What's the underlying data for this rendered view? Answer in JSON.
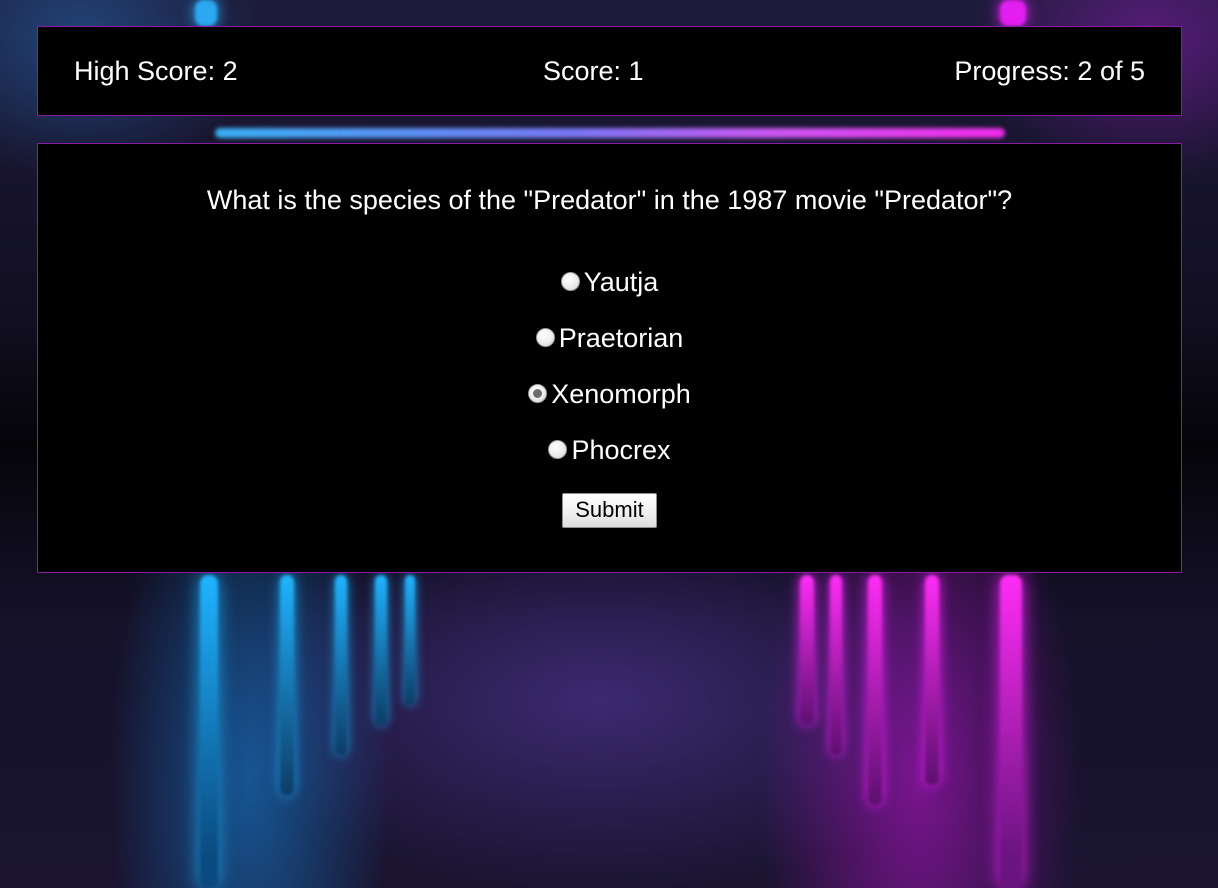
{
  "stats": {
    "high_score_label": "High Score: 2",
    "score_label": "Score: 1",
    "progress_label": "Progress: 2 of 5"
  },
  "quiz": {
    "question": "What is the species of the \"Predator\" in the 1987 movie \"Predator\"?",
    "options": [
      {
        "label": "Yautja",
        "selected": false
      },
      {
        "label": "Praetorian",
        "selected": false
      },
      {
        "label": "Xenomorph",
        "selected": true
      },
      {
        "label": "Phocrex",
        "selected": false
      }
    ],
    "submit_label": "Submit"
  },
  "colors": {
    "panel_background": "#000000",
    "panel_border": "#8a1aa0",
    "text": "#ffffff",
    "neon_blue": "#2aa8f0",
    "neon_magenta": "#e21ef0"
  }
}
